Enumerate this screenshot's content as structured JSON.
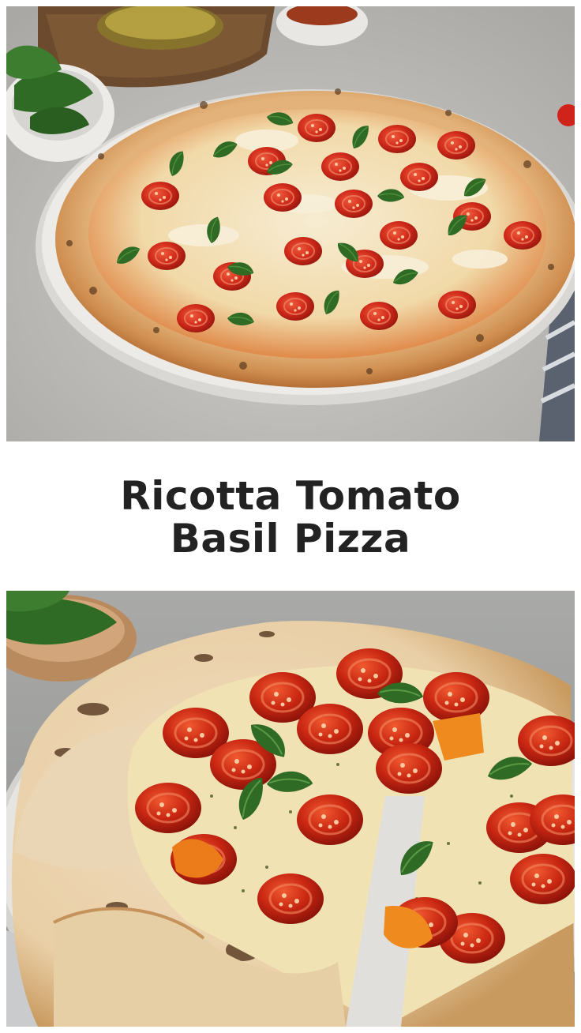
{
  "title": {
    "line1": "Ricotta Tomato",
    "line2": "Basil Pizza"
  },
  "images": {
    "top": "whole-pizza-photo",
    "bottom": "sliced-pizza-photo"
  },
  "colors": {
    "title_text": "#222222",
    "background": "#ffffff",
    "crust": "#d9a05b",
    "tomato": "#c8281c",
    "basil": "#2f6b25",
    "cheese": "#f3e3b8",
    "counter": "#c9c9c7"
  }
}
